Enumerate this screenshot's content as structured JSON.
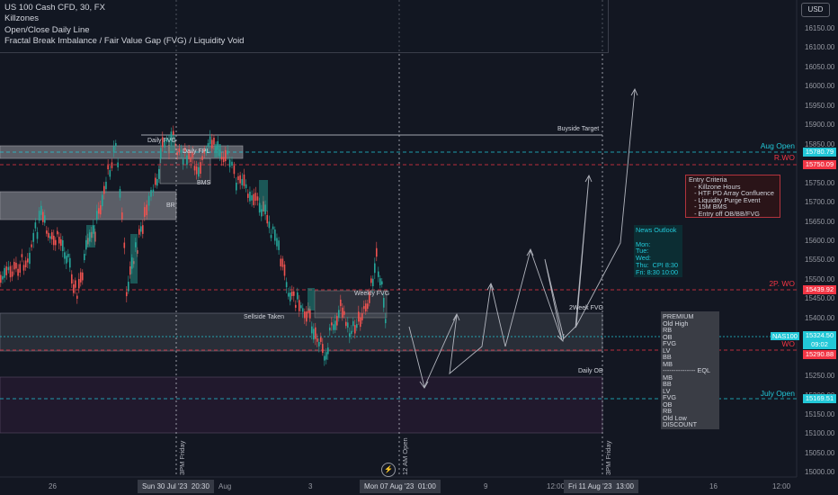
{
  "legend": {
    "symbol": "US 100 Cash CFD, 30, FX",
    "ind1": "Killzones",
    "ind2": "Open/Close Daily Line",
    "ind3": "Fractal Break Imbalance / Fair Value Gap (FVG) / Liquidity Void"
  },
  "currency": "USD",
  "price_axis": {
    "ticks": [
      "16150.00",
      "16100.00",
      "16050.00",
      "16000.00",
      "15950.00",
      "15900.00",
      "15850.00",
      "15800.00",
      "15750.00",
      "15700.00",
      "15650.00",
      "15600.00",
      "15550.00",
      "15500.00",
      "15450.00",
      "15400.00",
      "15350.00",
      "15300.00",
      "15250.00",
      "15200.00",
      "15150.00",
      "15100.00",
      "15050.00",
      "15000.00"
    ]
  },
  "time_axis": {
    "labels": [
      "26",
      "Aug",
      "3",
      "9",
      "12:00",
      "16",
      "12:00"
    ],
    "highlights": [
      "Sun 30 Jul '23",
      "20:30",
      "Mon 07 Aug '23",
      "01:00",
      "Fri 11 Aug '23",
      "13:00"
    ]
  },
  "price_tags": {
    "aug_open_tag": "15780.79",
    "rwo_tag": "15750.09",
    "twowo_tag": "15439.92",
    "current_price": "15324.50",
    "countdown": "09:02",
    "wo_tag": "15290.88",
    "july_open_tag": "15169.51"
  },
  "line_labels": {
    "aug_open": "Aug Open",
    "rwo": "R.WO",
    "twowo": "2P. WO",
    "symbol_short": "NAS100",
    "wo": "WO",
    "july_open": "July Open"
  },
  "chart_labels": {
    "buyside": "Buyside Target",
    "daily_fvg": "Daily FVG",
    "daily_fpl": "Daily FPL",
    "bms": "BMS",
    "br": "BR",
    "sellside": "Sellside Taken",
    "weekly_fvg": "Weekly FVG",
    "twoweek_fvg": "2Week FVG",
    "daily_ob": "Daily OB"
  },
  "vertical_texts": {
    "v1": "3PM Friday",
    "v2": "12 AM Open",
    "v3": "3PM Friday"
  },
  "entry_criteria": [
    "Entry Criteria",
    "   - Killzone Hours",
    "   - HTF PD Array Confluence",
    "   - Liquidity Purge Event",
    "   - 15M BMS",
    "   - Entry off OB/BB/FVG"
  ],
  "news": [
    "News Outlook",
    "",
    "Mon:",
    "Tue:",
    "Wed:",
    "Thu:  CPI 8:30",
    "Fri: 8:30 10:00"
  ],
  "premium": [
    "PREMIUM",
    "Old High",
    "RB",
    "OB",
    "FVG",
    "LV",
    "BB",
    "MB",
    "--------------- EQL",
    "MB",
    "BB",
    "LV",
    "FVG",
    "OB",
    "RB",
    "Old Low",
    "DISCOUNT"
  ],
  "colors": {
    "background": "#131722",
    "bull": "#26a69a",
    "bear": "#ef5350",
    "aug_open": "#22c8d8",
    "rwo": "#f23645"
  },
  "icons": {
    "replay": "bolt-icon"
  }
}
